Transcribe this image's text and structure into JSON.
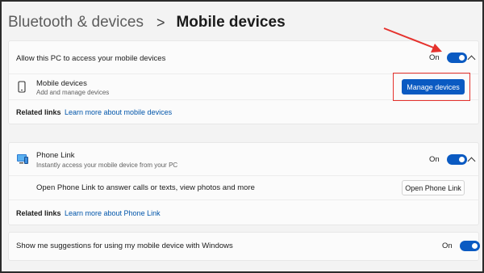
{
  "breadcrumb": {
    "parent": "Bluetooth & devices",
    "separator": ">",
    "current": "Mobile devices"
  },
  "access_card": {
    "allow_label": "Allow this PC to access your mobile devices",
    "allow_toggle_state": "On",
    "mobile_devices_title": "Mobile devices",
    "mobile_devices_subtitle": "Add and manage devices",
    "manage_button": "Manage devices",
    "related_label": "Related links",
    "related_link": "Learn more about mobile devices"
  },
  "phone_link_card": {
    "title": "Phone Link",
    "subtitle": "Instantly access your mobile device from your PC",
    "toggle_state": "On",
    "open_description": "Open Phone Link to answer calls or texts, view photos and more",
    "open_button": "Open Phone Link",
    "related_label": "Related links",
    "related_link": "Learn more about Phone Link"
  },
  "suggestions_card": {
    "label": "Show me suggestions for using my mobile device with Windows",
    "toggle_state": "On"
  },
  "colors": {
    "accent": "#0a5ac2",
    "annotation": "#e5322d",
    "link": "#0055aa"
  },
  "icons": {
    "phone": "phone-icon",
    "phone_link": "phone-link-icon",
    "chevron": "chevron-up-icon"
  }
}
